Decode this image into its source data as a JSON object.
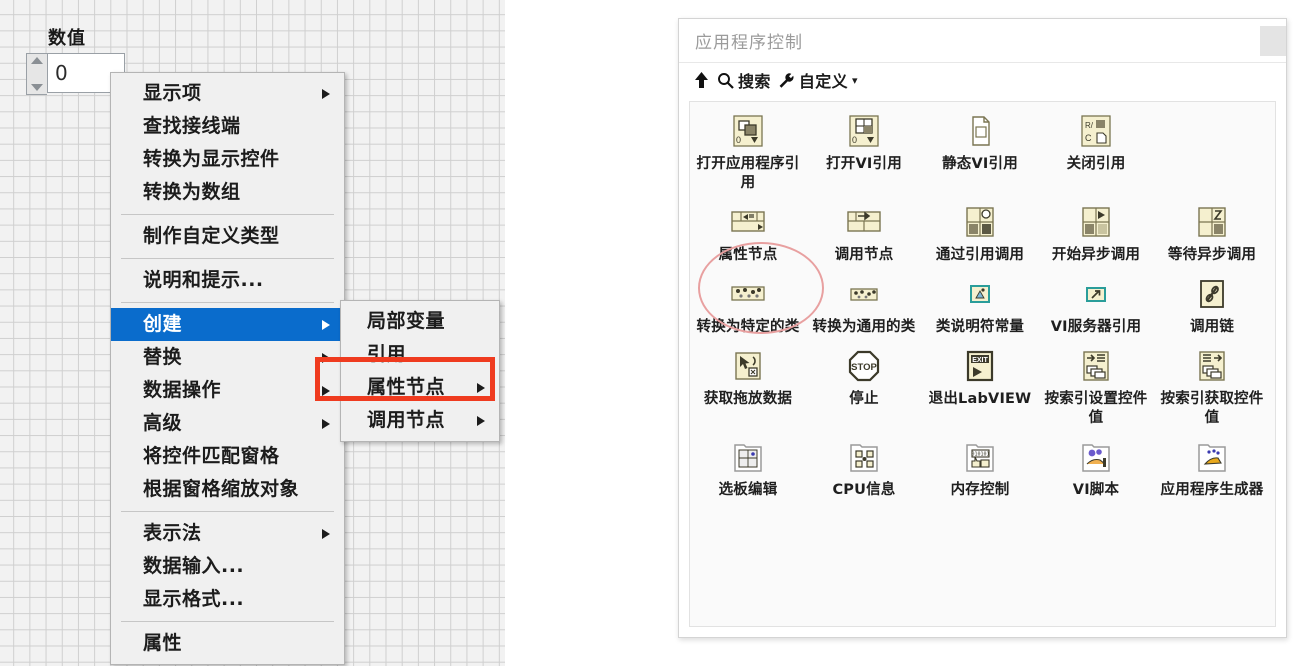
{
  "front_panel": {
    "numeric_control": {
      "label": "数值",
      "value": "0",
      "spin_up_icon": "triangle-up-icon",
      "spin_down_icon": "triangle-down-icon"
    }
  },
  "context_menu": {
    "items": [
      {
        "label": "显示项",
        "has_submenu": true,
        "separator_after": false,
        "selected": false
      },
      {
        "label": "查找接线端",
        "has_submenu": false,
        "separator_after": false,
        "selected": false
      },
      {
        "label": "转换为显示控件",
        "has_submenu": false,
        "separator_after": false,
        "selected": false
      },
      {
        "label": "转换为数组",
        "has_submenu": false,
        "separator_after": true,
        "selected": false
      },
      {
        "label": "制作自定义类型",
        "has_submenu": false,
        "separator_after": true,
        "selected": false
      },
      {
        "label": "说明和提示...",
        "has_submenu": false,
        "separator_after": true,
        "selected": false
      },
      {
        "label": "创建",
        "has_submenu": true,
        "separator_after": false,
        "selected": true
      },
      {
        "label": "替换",
        "has_submenu": true,
        "separator_after": false,
        "selected": false
      },
      {
        "label": "数据操作",
        "has_submenu": true,
        "separator_after": false,
        "selected": false
      },
      {
        "label": "高级",
        "has_submenu": true,
        "separator_after": false,
        "selected": false
      },
      {
        "label": "将控件匹配窗格",
        "has_submenu": false,
        "separator_after": false,
        "selected": false
      },
      {
        "label": "根据窗格缩放对象",
        "has_submenu": false,
        "separator_after": true,
        "selected": false
      },
      {
        "label": "表示法",
        "has_submenu": true,
        "separator_after": false,
        "selected": false
      },
      {
        "label": "数据输入...",
        "has_submenu": false,
        "separator_after": false,
        "selected": false
      },
      {
        "label": "显示格式...",
        "has_submenu": false,
        "separator_after": true,
        "selected": false
      },
      {
        "label": "属性",
        "has_submenu": false,
        "separator_after": false,
        "selected": false
      }
    ]
  },
  "submenu": {
    "parent": "创建",
    "items": [
      {
        "label": "局部变量",
        "has_submenu": false
      },
      {
        "label": "引用",
        "has_submenu": false
      },
      {
        "label": "属性节点",
        "has_submenu": true
      },
      {
        "label": "调用节点",
        "has_submenu": true
      }
    ]
  },
  "annotations": {
    "highlight_rect_color": "#ef3b1f",
    "highlight_rect_target": "属性节点",
    "ellipse_color": "#e8a0a0",
    "ellipse_target": "属性节点"
  },
  "palette": {
    "title": "应用程序控制",
    "title_button_icon": "palette-pin-icon",
    "toolbar": {
      "up_label": "",
      "up_icon": "arrow-up-icon",
      "search_label": "搜索",
      "search_icon": "search-icon",
      "customize_label": "自定义",
      "customize_icon": "wrench-icon",
      "customize_caret": "▾"
    },
    "rows": [
      [
        {
          "label": "打开应用程序引用",
          "icon": "open-application-reference-icon"
        },
        {
          "label": "打开VI引用",
          "icon": "open-vi-reference-icon"
        },
        {
          "label": "静态VI引用",
          "icon": "static-vi-reference-icon"
        },
        {
          "label": "关闭引用",
          "icon": "close-reference-icon"
        }
      ],
      [
        {
          "label": "属性节点",
          "icon": "property-node-icon",
          "highlighted": true
        },
        {
          "label": "调用节点",
          "icon": "invoke-node-icon"
        },
        {
          "label": "通过引用调用",
          "icon": "call-by-reference-icon"
        },
        {
          "label": "开始异步调用",
          "icon": "start-async-call-icon"
        },
        {
          "label": "等待异步调用",
          "icon": "wait-async-call-icon"
        }
      ],
      [
        {
          "label": "转换为特定的类",
          "icon": "to-more-specific-class-icon"
        },
        {
          "label": "转换为通用的类",
          "icon": "to-more-generic-class-icon"
        },
        {
          "label": "类说明符常量",
          "icon": "class-specifier-constant-icon"
        },
        {
          "label": "VI服务器引用",
          "icon": "vi-server-reference-icon"
        },
        {
          "label": "调用链",
          "icon": "call-chain-icon"
        }
      ],
      [
        {
          "label": "获取拖放数据",
          "icon": "get-drag-drop-data-icon"
        },
        {
          "label": "停止",
          "icon": "stop-icon"
        },
        {
          "label": "退出LabVIEW",
          "icon": "quit-labview-icon"
        },
        {
          "label": "按索引设置控件值",
          "icon": "set-control-value-by-index-icon"
        },
        {
          "label": "按索引获取控件值",
          "icon": "get-control-value-by-index-icon"
        }
      ],
      [
        {
          "label": "选板编辑",
          "icon": "palette-editor-icon"
        },
        {
          "label": "CPU信息",
          "icon": "cpu-information-icon"
        },
        {
          "label": "内存控制",
          "icon": "memory-control-icon"
        },
        {
          "label": "VI脚本",
          "icon": "vi-scripting-icon"
        },
        {
          "label": "应用程序生成器",
          "icon": "application-builder-icon"
        }
      ]
    ]
  }
}
